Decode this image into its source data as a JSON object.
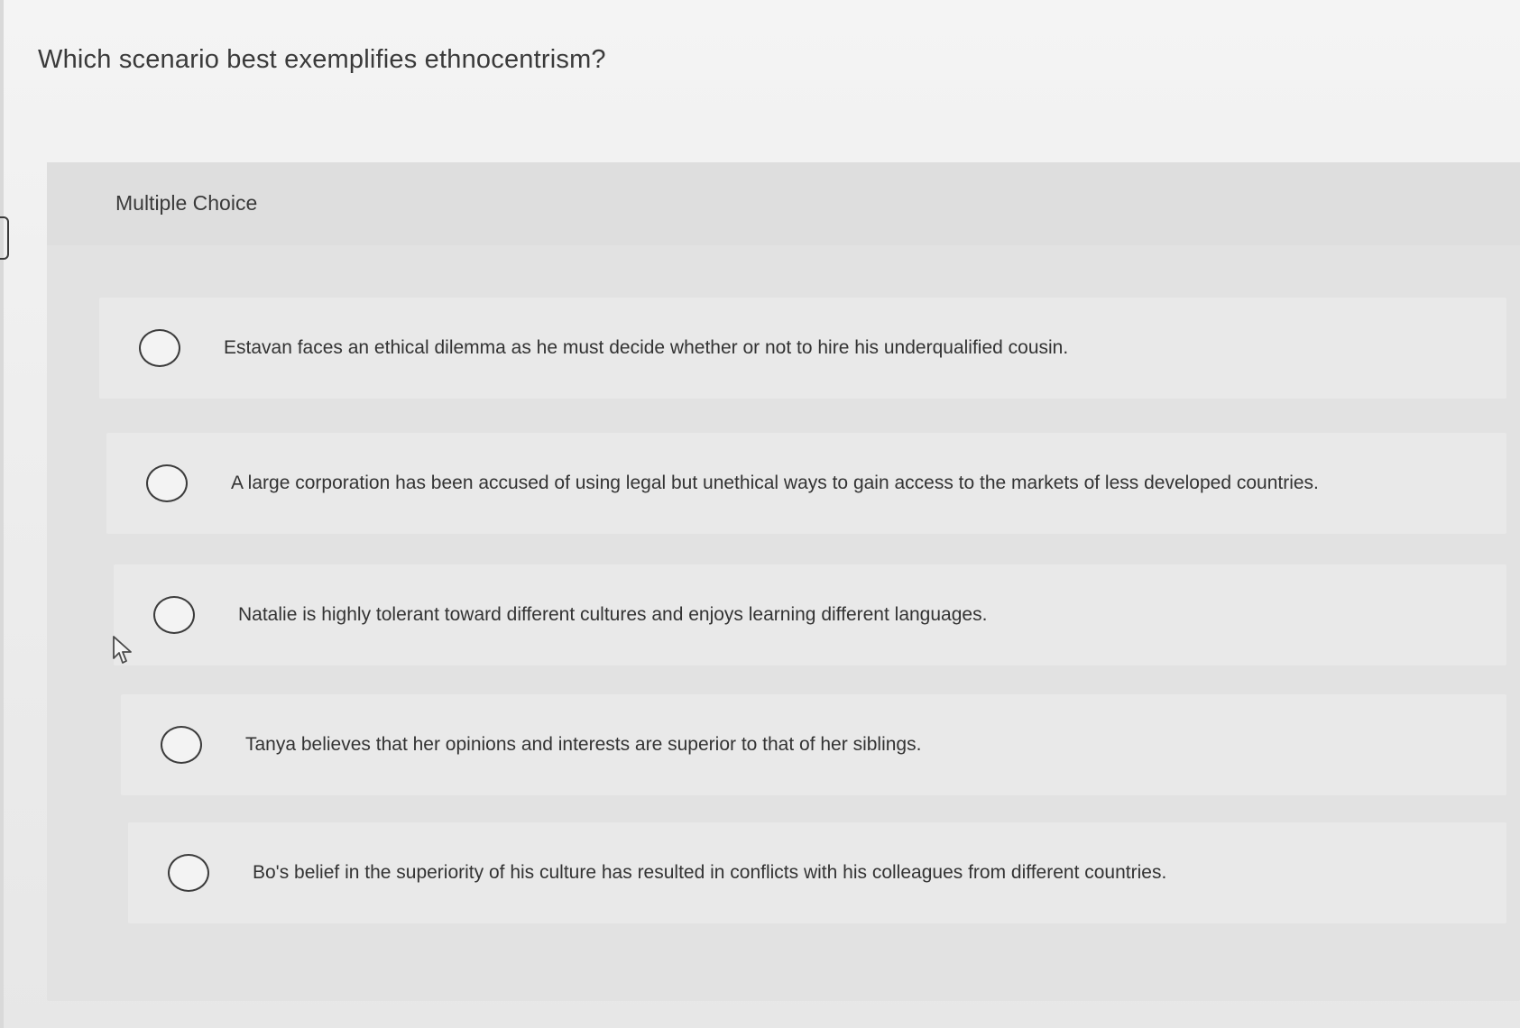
{
  "question": {
    "text": "Which scenario best exemplifies ethnocentrism?"
  },
  "section": {
    "label": "Multiple Choice"
  },
  "choices": [
    {
      "label": "Estavan faces an ethical dilemma as he must decide whether or not to hire his underqualified cousin.",
      "selected": false
    },
    {
      "label": "A large corporation has been accused of using legal but unethical ways to gain access to the markets of less developed countries.",
      "selected": false
    },
    {
      "label": "Natalie is highly tolerant toward different cultures and enjoys learning different languages.",
      "selected": false
    },
    {
      "label": "Tanya believes that her opinions and interests are superior to that of her siblings.",
      "selected": false
    },
    {
      "label": "Bo's belief in the superiority of his culture has resulted in conflicts with his colleagues from different countries.",
      "selected": false
    }
  ],
  "icons": {
    "radio": "radio-unchecked-icon",
    "cursor": "mouse-pointer-icon"
  }
}
